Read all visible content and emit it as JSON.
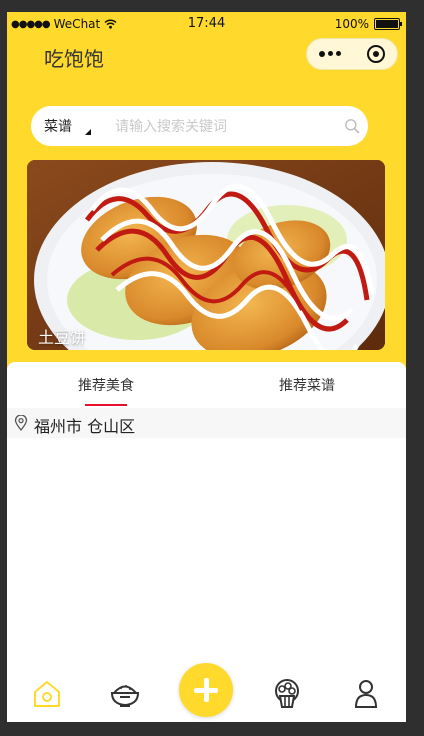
{
  "status_bar": {
    "carrier": "WeChat",
    "time": "17:44",
    "battery": "100%"
  },
  "header": {
    "app_title": "吃饱饱"
  },
  "search": {
    "category": "菜谱",
    "placeholder": "请输入搜索关键词"
  },
  "banner": {
    "caption": "土豆饼"
  },
  "content_tabs": [
    {
      "label": "推荐美食",
      "active": true
    },
    {
      "label": "推荐菜谱",
      "active": false
    }
  ],
  "location": {
    "text": "福州市 仓山区"
  },
  "bottom_tabs": [
    {
      "icon": "home-icon",
      "active": true
    },
    {
      "icon": "rice-bowl-icon",
      "active": false
    },
    {
      "icon": "add-icon",
      "active": false
    },
    {
      "icon": "popcorn-icon",
      "active": false
    },
    {
      "icon": "user-icon",
      "active": false
    }
  ],
  "colors": {
    "brand_yellow": "#ffd92b",
    "tab_indicator": "#e8112d",
    "active_icon": "#ffd92b"
  }
}
